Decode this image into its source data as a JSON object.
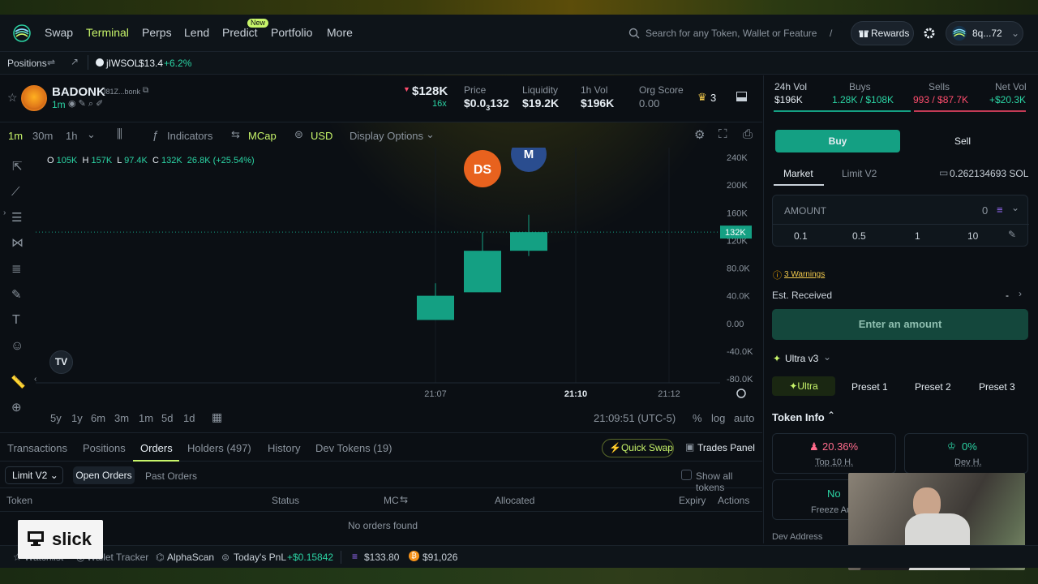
{
  "nav": {
    "items": [
      "Swap",
      "Terminal",
      "Perps",
      "Lend",
      "Predict",
      "Portfolio",
      "More"
    ],
    "active": "Terminal",
    "new_badge": "New",
    "search_placeholder": "Search for any Token, Wallet or Feature",
    "search_shortcut": "/",
    "rewards": "Rewards",
    "wallet": "8q...72"
  },
  "positions_bar": {
    "label": "Positions",
    "token": "jIWSOL",
    "price": "$13.4",
    "change": "+6.2%"
  },
  "token": {
    "name": "BADONK",
    "address": "J81Z...bonk",
    "age": "1m",
    "mcap": "$128K",
    "multiplier": "16x",
    "price_label": "Price",
    "price_main": "$0.0",
    "price_sub": "3",
    "price_tail": "132",
    "liquidity_label": "Liquidity",
    "liquidity": "$19.2K",
    "vol_label": "1h Vol",
    "vol": "$196K",
    "score_label": "Org Score",
    "score": "0.00",
    "crown_count": "3"
  },
  "chart_toolbar": {
    "timeframes": [
      "1m",
      "30m",
      "1h"
    ],
    "indicators": "Indicators",
    "mcap": "MCap",
    "usd": "USD",
    "display": "Display Options"
  },
  "ohlc": {
    "o_label": "O",
    "o": "105K",
    "h_label": "H",
    "h": "157K",
    "l_label": "L",
    "l": "97.4K",
    "c_label": "C",
    "c": "132K",
    "change": "26.8K (+25.54%)"
  },
  "chart_data": {
    "type": "candlestick",
    "x_ticks": [
      "21:07",
      "21:10",
      "21:12"
    ],
    "y_ticks": [
      "240K",
      "200K",
      "160K",
      "120K",
      "80.0K",
      "40.0K",
      "0.00",
      "-40.0K",
      "-80.0K"
    ],
    "y_tick_values": [
      240,
      200,
      160,
      120,
      80,
      40,
      0,
      -40,
      -80
    ],
    "ylim": [
      -80,
      240
    ],
    "candles": [
      {
        "open": 5,
        "close": 40,
        "high": 58,
        "low": 5
      },
      {
        "open": 45,
        "close": 105,
        "high": 132,
        "low": 45
      },
      {
        "open": 105,
        "close": 132,
        "high": 157,
        "low": 97.4
      }
    ],
    "current_value": 132,
    "current_label": "132K",
    "markers": [
      "DS",
      "M"
    ],
    "colors": {
      "up": "#14a083",
      "marker_ds": "#e8621e",
      "marker_m": "#2a4d8f"
    }
  },
  "range_bar": {
    "ranges": [
      "5y",
      "1y",
      "6m",
      "3m",
      "1m",
      "5d",
      "1d"
    ],
    "time": "21:09:51 (UTC-5)",
    "pct": "%",
    "log": "log",
    "auto": "auto"
  },
  "orders": {
    "tabs": [
      "Transactions",
      "Positions",
      "Orders",
      "Holders (497)",
      "History",
      "Dev Tokens (19)"
    ],
    "active": "Orders",
    "quick_swap": "Quick Swap",
    "trades_panel": "Trades Panel",
    "type_select": "Limit V2",
    "subtabs": [
      "Open Orders",
      "Past Orders"
    ],
    "show_all": "Show all tokens",
    "columns": [
      "Token",
      "Status",
      "MC",
      "Allocated",
      "Expiry",
      "Actions"
    ],
    "empty": "No orders found"
  },
  "right": {
    "stats": [
      {
        "label": "24h Vol",
        "value": "$196K"
      },
      {
        "label": "Buys",
        "value": "1.28K / $108K"
      },
      {
        "label": "Sells",
        "value": "993 / $87.7K"
      },
      {
        "label": "Net Vol",
        "value": "+$20.3K"
      }
    ],
    "buy": "Buy",
    "sell": "Sell",
    "market": "Market",
    "limit": "Limit V2",
    "balance": "0.262134693 SOL",
    "amount_label": "AMOUNT",
    "amount_value": "0",
    "presets": [
      "0.1",
      "0.5",
      "1",
      "10"
    ],
    "warnings": "3 Warnings",
    "est_received": "Est. Received",
    "est_value": "-",
    "enter_amount": "Enter an amount",
    "ultra_version": "Ultra v3",
    "mode_tabs": [
      "Ultra",
      "Preset 1",
      "Preset 2",
      "Preset 3"
    ],
    "token_info": "Token Info",
    "top10_value": "20.36%",
    "top10_label": "Top 10 H.",
    "dev_value": "0%",
    "dev_label": "Dev H.",
    "freeze_value": "No",
    "freeze_label": "Freeze Auth",
    "dev_address": "Dev Address"
  },
  "footer": {
    "watchlist": "Watchlist",
    "wallet_tracker": "Wallet Tracker",
    "alphascan": "AlphaScan",
    "pnl_label": "Today's PnL",
    "pnl_value": "+$0.15842",
    "sol_price": "$133.80",
    "btc_price": "$91,026"
  },
  "watermark": "slick"
}
